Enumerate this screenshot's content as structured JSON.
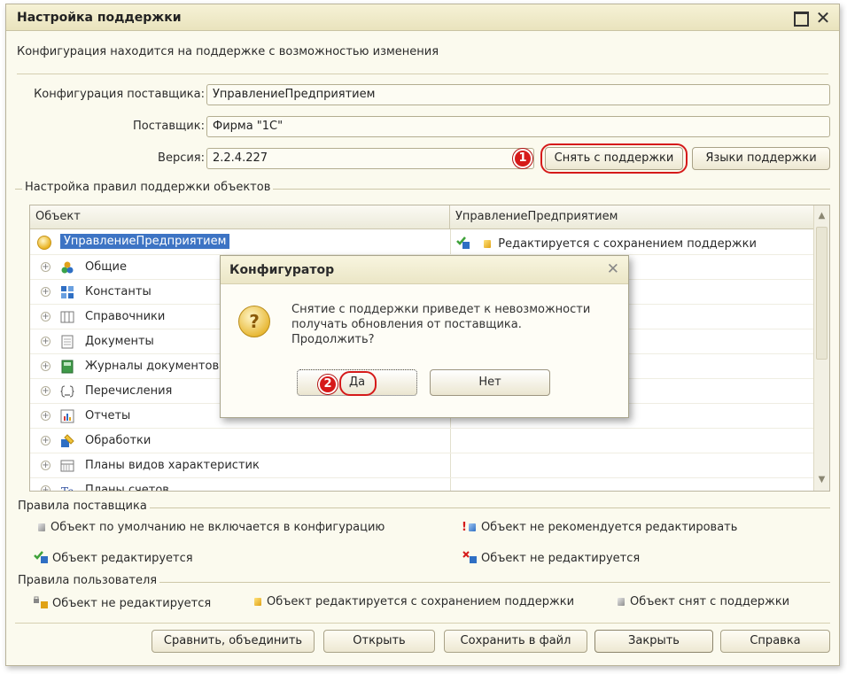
{
  "window": {
    "title": "Настройка поддержки",
    "info": "Конфигурация находится на поддержке с возможностью изменения"
  },
  "fields": {
    "vendor_config_label": "Конфигурация поставщика:",
    "vendor_config_value": "УправлениеПредприятием",
    "vendor_label": "Поставщик:",
    "vendor_value": "Фирма \"1С\"",
    "version_label": "Версия:",
    "version_value": "2.2.4.227"
  },
  "buttons": {
    "remove_support": "Снять с поддержки",
    "support_languages": "Языки поддержки"
  },
  "badges": {
    "one": "1",
    "two": "2"
  },
  "group_rules": "Настройка правил поддержки объектов",
  "table": {
    "col_object": "Объект",
    "col_config": "УправлениеПредприятием",
    "rows": [
      {
        "label": "УправлениеПредприятием",
        "state": "Редактируется с сохранением поддержки"
      },
      {
        "label": "Общие"
      },
      {
        "label": "Константы"
      },
      {
        "label": "Справочники"
      },
      {
        "label": "Документы"
      },
      {
        "label": "Журналы документов"
      },
      {
        "label": "Перечисления"
      },
      {
        "label": "Отчеты"
      },
      {
        "label": "Обработки"
      },
      {
        "label": "Планы видов характеристик"
      },
      {
        "label": "Планы счетов"
      }
    ]
  },
  "vendor_rules": {
    "title": "Правила поставщика",
    "not_included": "Объект по умолчанию не включается в конфигурацию",
    "not_recommended": "Объект не рекомендуется редактировать",
    "editable": "Объект редактируется",
    "not_editable": "Объект не редактируется"
  },
  "user_rules": {
    "title": "Правила пользователя",
    "not_editable": "Объект не редактируется",
    "editable_keep": "Объект редактируется с сохранением поддержки",
    "removed": "Объект снят с поддержки"
  },
  "bottom_buttons": {
    "compare": "Сравнить, объединить",
    "open": "Открыть",
    "save": "Сохранить в файл",
    "close": "Закрыть",
    "help": "Справка"
  },
  "dialog": {
    "title": "Конфигуратор",
    "line1": "Снятие с поддержки приведет к невозможности",
    "line2": "получать обновления от поставщика.",
    "line3": "Продолжить?",
    "yes": "Да",
    "no": "Нет"
  },
  "colors": {
    "accent_red": "#d51a1a",
    "selection_blue": "#3d74c4",
    "window_bg": "#fbfaee"
  }
}
